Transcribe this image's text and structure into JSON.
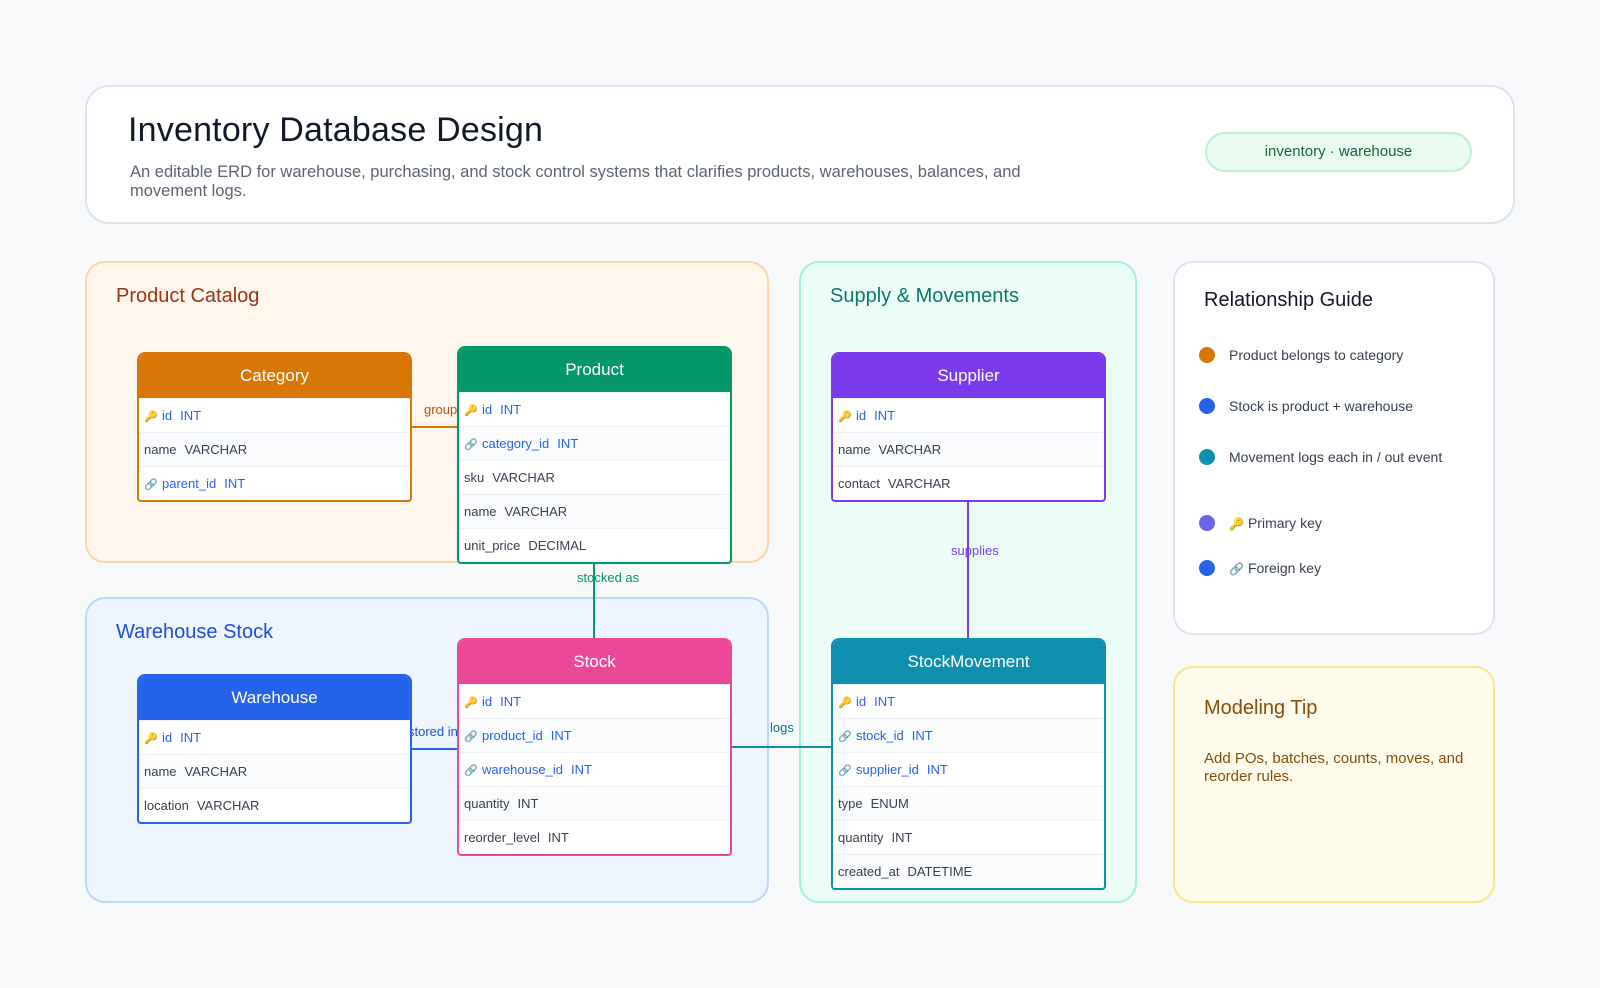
{
  "header": {
    "title": "Inventory Database Design",
    "subtitle": "An editable ERD for warehouse, purchasing, and stock control systems that clarifies products, warehouses, balances, and movement logs.",
    "tag": "inventory · warehouse"
  },
  "groups": {
    "catalog": "Product Catalog",
    "stock": "Warehouse Stock",
    "supply": "Supply & Movements"
  },
  "entities": {
    "category": {
      "name": "Category",
      "rows": [
        {
          "name": "id",
          "type": "INT",
          "icon": "key-icon"
        },
        {
          "name": "name",
          "type": "VARCHAR"
        },
        {
          "name": "parent_id",
          "type": "INT",
          "icon": "link-icon"
        }
      ]
    },
    "product": {
      "name": "Product",
      "rows": [
        {
          "name": "id",
          "type": "INT",
          "icon": "key-icon"
        },
        {
          "name": "category_id",
          "type": "INT",
          "icon": "link-icon"
        },
        {
          "name": "sku",
          "type": "VARCHAR"
        },
        {
          "name": "name",
          "type": "VARCHAR"
        },
        {
          "name": "unit_price",
          "type": "DECIMAL"
        }
      ]
    },
    "warehouse": {
      "name": "Warehouse",
      "rows": [
        {
          "name": "id",
          "type": "INT",
          "icon": "key-icon"
        },
        {
          "name": "name",
          "type": "VARCHAR"
        },
        {
          "name": "location",
          "type": "VARCHAR"
        }
      ]
    },
    "stock": {
      "name": "Stock",
      "rows": [
        {
          "name": "id",
          "type": "INT",
          "icon": "key-icon"
        },
        {
          "name": "product_id",
          "type": "INT",
          "icon": "link-icon"
        },
        {
          "name": "warehouse_id",
          "type": "INT",
          "icon": "link-icon"
        },
        {
          "name": "quantity",
          "type": "INT"
        },
        {
          "name": "reorder_level",
          "type": "INT"
        }
      ]
    },
    "supplier": {
      "name": "Supplier",
      "rows": [
        {
          "name": "id",
          "type": "INT",
          "icon": "key-icon"
        },
        {
          "name": "name",
          "type": "VARCHAR"
        },
        {
          "name": "contact",
          "type": "VARCHAR"
        }
      ]
    },
    "movement": {
      "name": "StockMovement",
      "rows": [
        {
          "name": "id",
          "type": "INT",
          "icon": "key-icon"
        },
        {
          "name": "stock_id",
          "type": "INT",
          "icon": "link-icon"
        },
        {
          "name": "supplier_id",
          "type": "INT",
          "icon": "link-icon"
        },
        {
          "name": "type",
          "type": "ENUM"
        },
        {
          "name": "quantity",
          "type": "INT"
        },
        {
          "name": "created_at",
          "type": "DATETIME"
        }
      ]
    }
  },
  "relations": {
    "groups": "groups",
    "stocked_as": "stocked as",
    "stored_in": "stored in",
    "logs": "logs",
    "supplies": "supplies"
  },
  "guide": {
    "title": "Relationship Guide",
    "items": [
      {
        "text": "Product belongs to category",
        "color": "#d97706"
      },
      {
        "text": "Stock is product + warehouse",
        "color": "#2563eb"
      },
      {
        "text": "Movement logs each in / out event",
        "color": "#0e8fae"
      },
      {
        "text": "Primary key",
        "color": "#6d63e6",
        "icon": "key-icon"
      },
      {
        "text": "Foreign key",
        "color": "#2563eb",
        "icon": "link-icon"
      }
    ]
  },
  "tip": {
    "title": "Modeling Tip",
    "body": "Add POs, batches, counts, moves, and reorder rules."
  },
  "colors": {
    "catalog": "#d97706",
    "product": "#059669",
    "warehouse": "#2563eb",
    "stock": "#ec4899",
    "supplier": "#7c3aed",
    "movement": "#0e8fae"
  }
}
